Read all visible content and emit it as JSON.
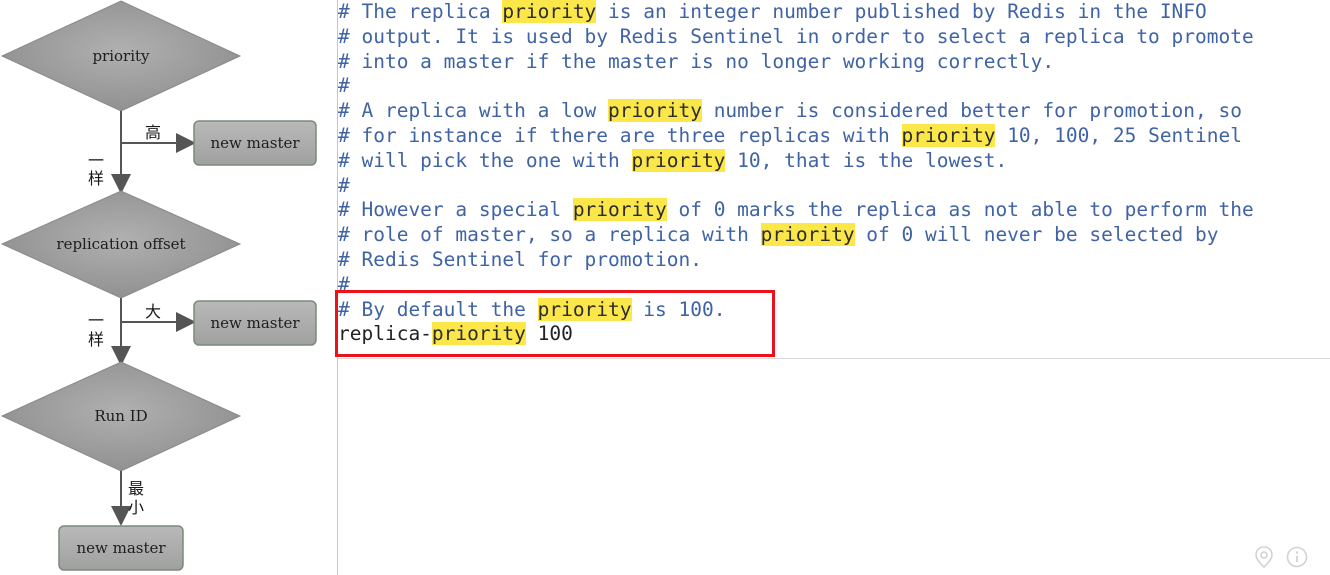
{
  "flowchart": {
    "decision_1": "priority",
    "decision_2": "replication offset",
    "decision_3": "Run ID",
    "branch_1_label": "高",
    "branch_2_label": "大",
    "branch_3_label_top": "最",
    "branch_3_label_bottom": "小",
    "same_label_1_top": "一",
    "same_label_1_bottom": "样",
    "same_label_2_top": "一",
    "same_label_2_bottom": "样",
    "result_1": "new master",
    "result_2": "new master",
    "result_3": "new master"
  },
  "code": {
    "lines": [
      [
        {
          "t": "# The replica ",
          "c": "com"
        },
        {
          "t": "priority",
          "c": "hl"
        },
        {
          "t": " is an integer number published by Redis in the INFO",
          "c": "com"
        }
      ],
      [
        {
          "t": "# output. It is used by Redis Sentinel in order to select a replica to promote",
          "c": "com"
        }
      ],
      [
        {
          "t": "# into a master if the master is no longer working correctly.",
          "c": "com"
        }
      ],
      [
        {
          "t": "#",
          "c": "com"
        }
      ],
      [
        {
          "t": "# A replica with a low ",
          "c": "com"
        },
        {
          "t": "priority",
          "c": "hl"
        },
        {
          "t": " number is considered better for promotion, so",
          "c": "com"
        }
      ],
      [
        {
          "t": "# for instance if there are three replicas with ",
          "c": "com"
        },
        {
          "t": "priority",
          "c": "hl"
        },
        {
          "t": " 10, 100, 25 Sentinel",
          "c": "com"
        }
      ],
      [
        {
          "t": "# will pick the one with ",
          "c": "com"
        },
        {
          "t": "priority",
          "c": "hl"
        },
        {
          "t": " 10, that is the lowest.",
          "c": "com"
        }
      ],
      [
        {
          "t": "#",
          "c": "com"
        }
      ],
      [
        {
          "t": "# However a special ",
          "c": "com"
        },
        {
          "t": "priority",
          "c": "hl"
        },
        {
          "t": " of 0 marks the replica as not able to perform the",
          "c": "com"
        }
      ],
      [
        {
          "t": "# role of master, so a replica with ",
          "c": "com"
        },
        {
          "t": "priority",
          "c": "hl"
        },
        {
          "t": " of 0 will never be selected by",
          "c": "com"
        }
      ],
      [
        {
          "t": "# Redis Sentinel for promotion.",
          "c": "com"
        }
      ],
      [
        {
          "t": "#",
          "c": "com"
        }
      ],
      [
        {
          "t": "# By default the ",
          "c": "com"
        },
        {
          "t": "priority",
          "c": "hl"
        },
        {
          "t": " is 100.",
          "c": "com"
        }
      ],
      [
        {
          "t": "replica-",
          "c": "code"
        },
        {
          "t": "priority",
          "c": "hl"
        },
        {
          "t": " 100",
          "c": "num"
        }
      ]
    ]
  },
  "icons": {
    "location": "location-pin-icon",
    "info": "info-icon"
  },
  "colors": {
    "diamond_fill": "#9e9e9e",
    "box_fill": "#ababab",
    "comment": "#3f63a4",
    "highlight": "#fbe74a",
    "outline_box": "#e8131b"
  }
}
